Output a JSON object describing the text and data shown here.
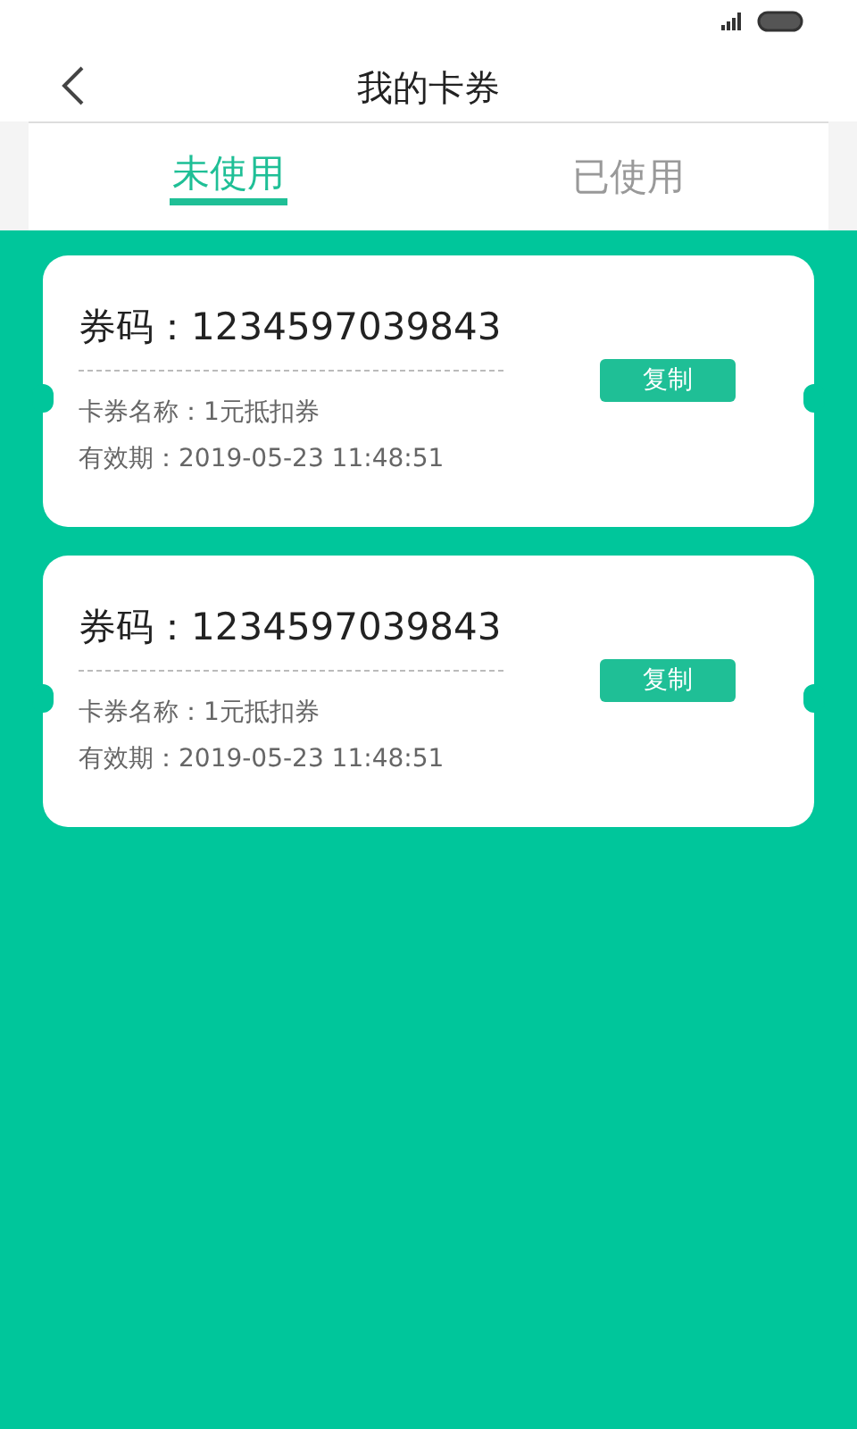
{
  "header": {
    "title": "我的卡券"
  },
  "tabs": [
    {
      "label": "未使用",
      "selected": true
    },
    {
      "label": "已使用",
      "selected": false
    }
  ],
  "coupons": [
    {
      "code": "券码：1234597039843",
      "name": "卡券名称：1元抵扣券",
      "expiry": "有效期：2019-05-23 11:48:51",
      "button": "复制"
    },
    {
      "code": "券码：1234597039843",
      "name": "卡券名称：1元抵扣券",
      "expiry": "有效期：2019-05-23 11:48:51",
      "button": "复制"
    }
  ]
}
